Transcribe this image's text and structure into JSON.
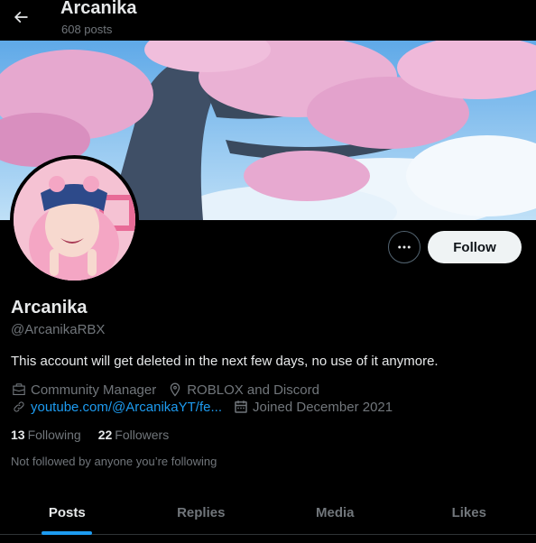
{
  "header": {
    "title": "Arcanika",
    "posts_count": "608 posts"
  },
  "profile": {
    "display_name": "Arcanika",
    "handle": "@ArcanikaRBX",
    "bio": "This account will get deleted in the next few days, no use of it anymore.",
    "category": "Community Manager",
    "location": "ROBLOX and Discord",
    "website": "youtube.com/@ArcanikaYT/fe...",
    "joined": "Joined December 2021",
    "following_count": "13",
    "following_label": "Following",
    "followers_count": "22",
    "followers_label": "Followers",
    "not_followed_text": "Not followed by anyone you’re following"
  },
  "actions": {
    "follow_label": "Follow"
  },
  "tabs": [
    {
      "label": "Posts",
      "active": true
    },
    {
      "label": "Replies",
      "active": false
    },
    {
      "label": "Media",
      "active": false
    },
    {
      "label": "Likes",
      "active": false
    }
  ],
  "colors": {
    "accent": "#1d9bf0",
    "background": "#000000",
    "secondary_text": "#71767b"
  }
}
